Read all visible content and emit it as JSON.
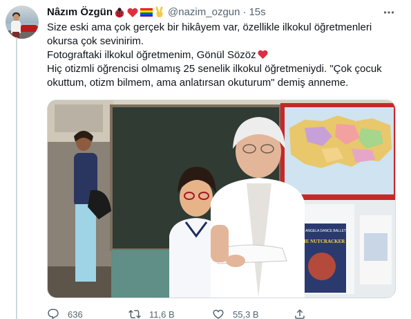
{
  "author": {
    "name": "Nâzım Özgün",
    "handle": "@nazim_ozgun",
    "separator": "·",
    "time": "15s",
    "name_emojis": [
      "ladybug-emoji",
      "red-heart-emoji",
      "rainbow-flag-emoji",
      "victory-hand-emoji"
    ]
  },
  "tweet": {
    "lines": [
      "Size eski ama çok gerçek bir hikâyem var, özellikle ilkokul öğretmenleri",
      "okursa çok sevinirim.",
      "Fotograftaki ilkokul öğretmenim, Gönül Sözöz",
      "Hiç otizmli öğrencisi olmamış 25 senelik ilkokul öğretmeniydi. \"Çok çocuk",
      "okuttum, otizm bilmem, ama anlatırsan okuturum\" demiş anneme."
    ],
    "line3_emoji": "red-heart-emoji"
  },
  "media": {
    "poster_title": "THE NUTCRACKER",
    "poster_small": "THE ANGELA DANCE BALLET"
  },
  "actions": {
    "reply_count": "636",
    "retweet_count": "11,6 B",
    "like_count": "55,3 B"
  },
  "colors": {
    "text": "#0f1419",
    "secondary": "#536471",
    "border": "#cfd9de",
    "heart": "#e0245e"
  },
  "icons": [
    "more-icon",
    "reply-icon",
    "retweet-icon",
    "like-icon",
    "share-icon"
  ]
}
